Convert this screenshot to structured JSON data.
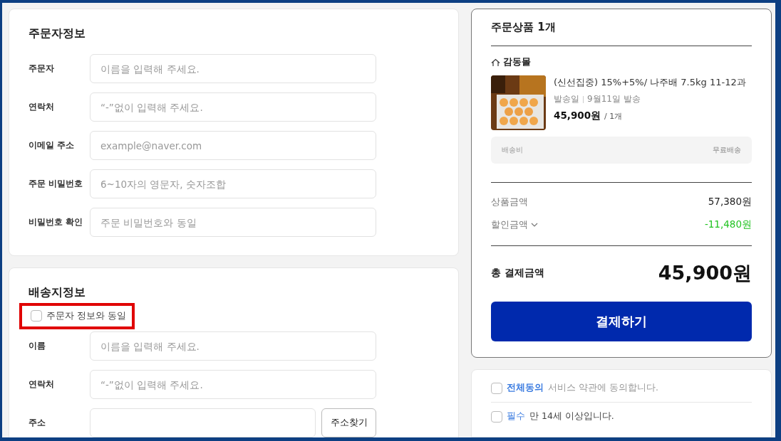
{
  "orderer": {
    "title": "주문자정보",
    "fields": [
      {
        "label": "주문자",
        "placeholder": "이름을 입력해 주세요."
      },
      {
        "label": "연락처",
        "placeholder": "“-”없이 입력해 주세요."
      },
      {
        "label": "이메일 주소",
        "placeholder": "example@naver.com"
      },
      {
        "label": "주문 비밀번호",
        "placeholder": "6~10자의 영문자, 숫자조합"
      },
      {
        "label": "비밀번호 확인",
        "placeholder": "주문 비밀번호와 동일"
      }
    ]
  },
  "shipping": {
    "title": "배송지정보",
    "same_as_orderer": {
      "label": "주문자 정보와 동일",
      "checked": false,
      "highlighted": true
    },
    "fields": [
      {
        "kind": "text",
        "label": "이름",
        "placeholder": "이름을 입력해 주세요."
      },
      {
        "kind": "text",
        "label": "연락처",
        "placeholder": "“-”없이 입력해 주세요."
      },
      {
        "kind": "address",
        "label": "주소",
        "button": "주소찾기"
      }
    ]
  },
  "summary": {
    "title": "주문상품 1개",
    "shop": "감동몰",
    "product": {
      "kind": "picture",
      "name": "(신선집중) 15%+5%/ 나주배 7.5kg 11-12과",
      "ship_label": "발송일",
      "ship_date": "9월11일 발송",
      "price": "45,900원",
      "quantity": "/ 1개"
    },
    "shipping_fee": {
      "label": "배송비",
      "value": "무료배송"
    },
    "rows": [
      {
        "kind": "plain",
        "label": "상품금액",
        "value": "57,380원"
      },
      {
        "kind": "discount",
        "label": "할인금액",
        "value": "-11,480원"
      }
    ],
    "total": {
      "label": "총 결제금액",
      "value": "45,900원"
    },
    "pay_button": "결제하기"
  },
  "terms": [
    {
      "kind": "all",
      "tag": "전체동의",
      "text": "서비스 약관에 동의합니다.",
      "checked": false
    },
    {
      "kind": "required",
      "tag": "필수",
      "text": "만 14세 이상입니다.",
      "checked": false
    }
  ]
}
